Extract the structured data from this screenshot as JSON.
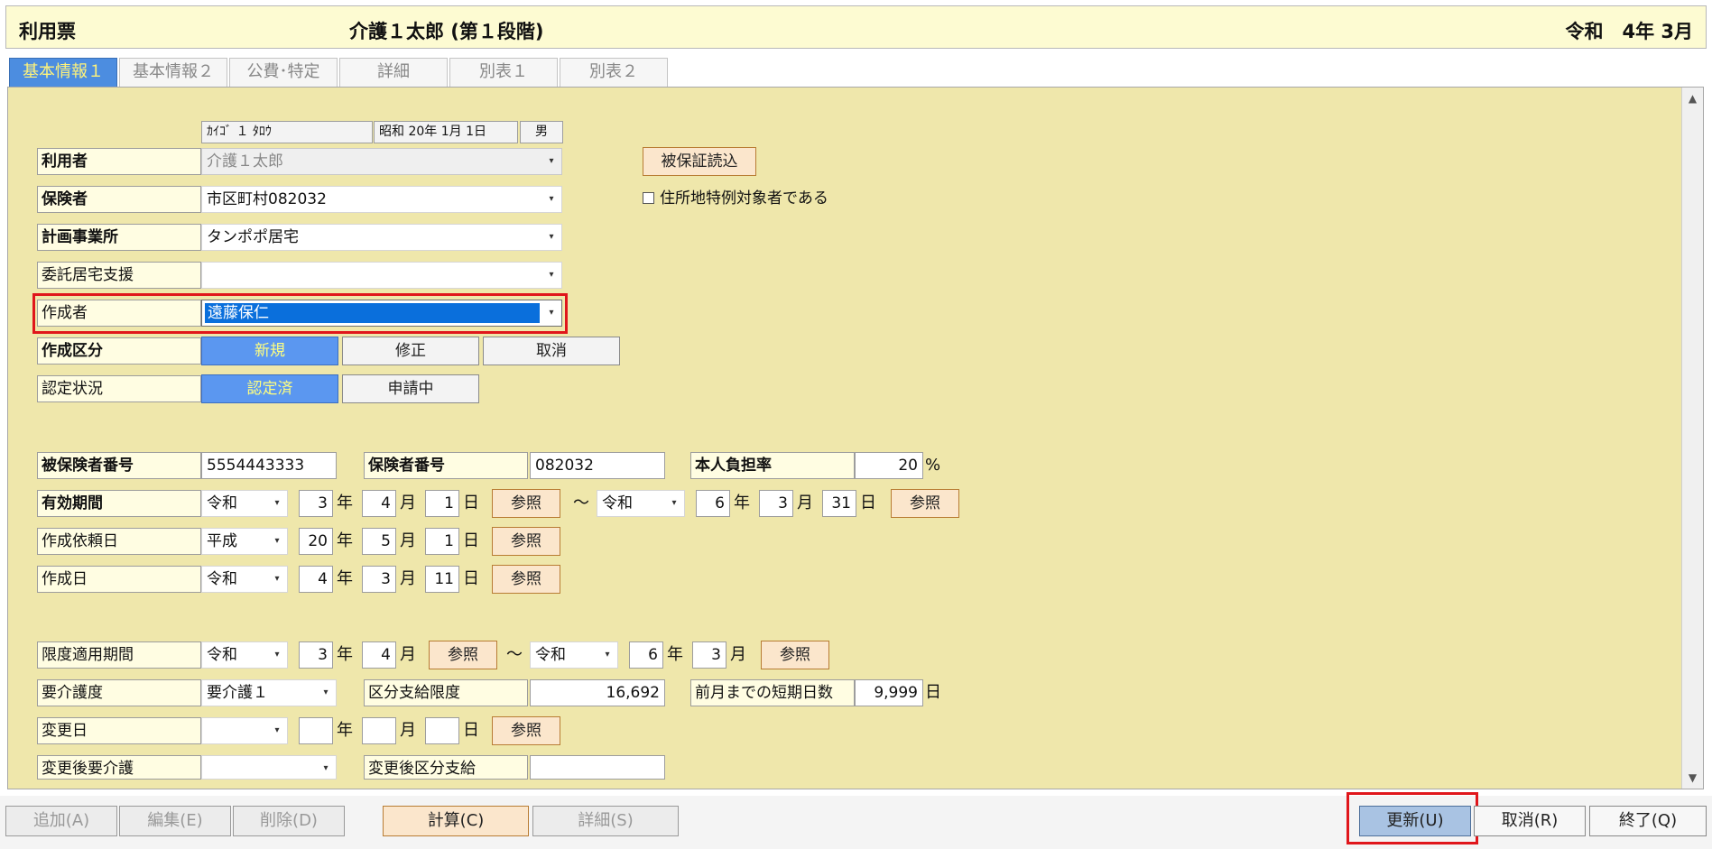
{
  "header": {
    "title": "利用票",
    "patient": "介護１太郎 (第１段階)",
    "period": "令和　4年 3月"
  },
  "tabs": [
    "基本情報１",
    "基本情報２",
    "公費･特定",
    "詳細",
    "別表１",
    "別表２"
  ],
  "profile": {
    "kana": "ｶｲｺﾞ １ ﾀﾛｳ",
    "birth": "昭和 20年 1月 1日",
    "sex": "男"
  },
  "labels": {
    "user": "利用者",
    "insurer": "保険者",
    "plan_office": "計画事業所",
    "consign": "委託居宅支援",
    "creator": "作成者",
    "create_type": "作成区分",
    "cert_status": "認定状況",
    "insured_no": "被保険者番号",
    "insurer_no": "保険者番号",
    "burden": "本人負担率",
    "valid_period": "有効期間",
    "request_date": "作成依頼日",
    "create_date": "作成日",
    "limit_period": "限度適用期間",
    "care_level": "要介護度",
    "limit_amount": "区分支給限度",
    "short_days": "前月までの短期日数",
    "change_date": "変更日",
    "changed_level": "変更後要介護",
    "changed_limit": "変更後区分支給"
  },
  "values": {
    "user": "介護１太郎",
    "insurer": "市区町村082032",
    "plan_office": "タンポポ居宅",
    "consign": "",
    "creator": "遠藤保仁",
    "insured_no": "5554443333",
    "insurer_no": "082032",
    "burden": "20",
    "valid_from_era": "令和",
    "valid_from_y": "3",
    "valid_from_m": "4",
    "valid_from_d": "1",
    "valid_to_era": "令和",
    "valid_to_y": "6",
    "valid_to_m": "3",
    "valid_to_d": "31",
    "req_era": "平成",
    "req_y": "20",
    "req_m": "5",
    "req_d": "1",
    "cre_era": "令和",
    "cre_y": "4",
    "cre_m": "3",
    "cre_d": "11",
    "lim_from_era": "令和",
    "lim_from_y": "3",
    "lim_from_m": "4",
    "lim_to_era": "令和",
    "lim_to_y": "6",
    "lim_to_m": "3",
    "care_level": "要介護１",
    "limit_amount": "16,692",
    "short_days": "9,999"
  },
  "units": {
    "year": "年",
    "month": "月",
    "day": "日",
    "percent": "%",
    "tilde": "〜"
  },
  "buttons": {
    "read_cert": "被保証読込",
    "ref": "参照",
    "new": "新規",
    "modify": "修正",
    "cancel_type": "取消",
    "certified": "認定済",
    "applying": "申請中"
  },
  "checkbox": {
    "address_special": "住所地特例対象者である"
  },
  "footer": {
    "add": "追加(A)",
    "edit": "編集(E)",
    "delete": "削除(D)",
    "calc": "計算(C)",
    "detail": "詳細(S)",
    "update": "更新(U)",
    "cancel": "取消(R)",
    "exit": "終了(Q)"
  }
}
